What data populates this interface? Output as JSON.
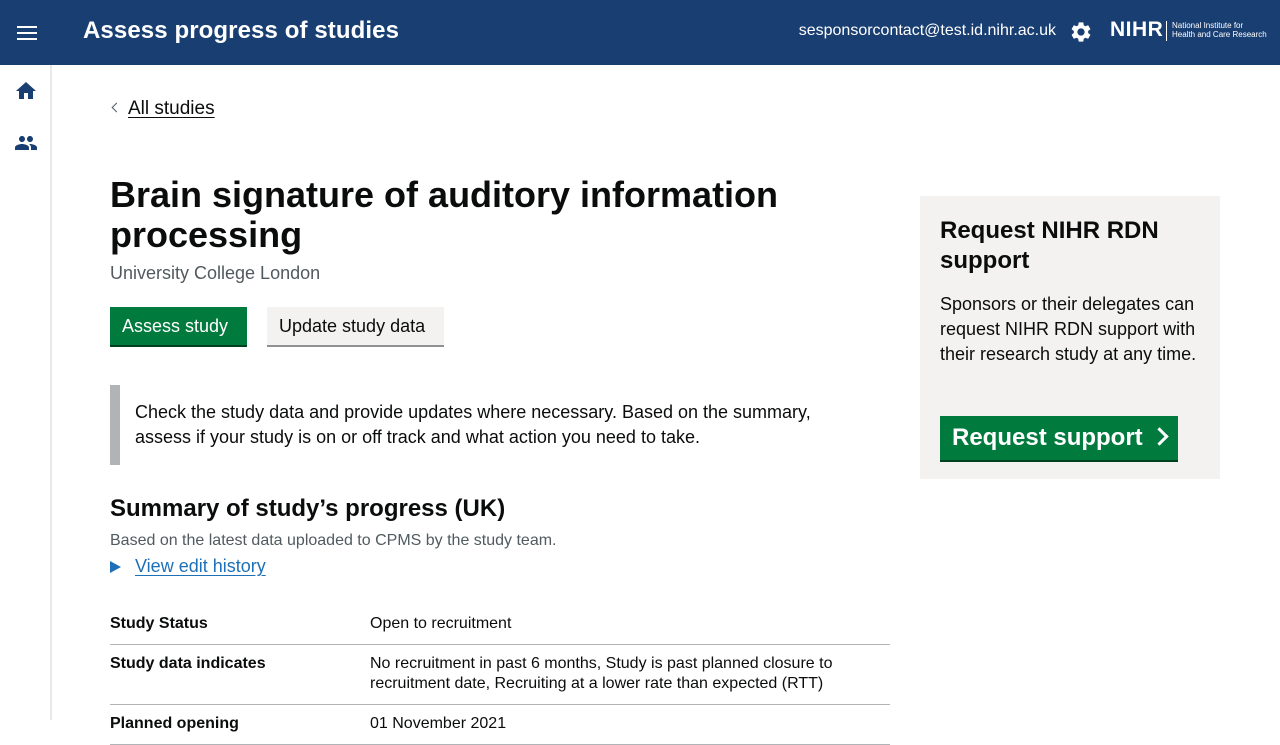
{
  "header": {
    "app_title": "Assess progress of studies",
    "user_email": "sesponsorcontact@test.id.nihr.ac.uk",
    "logo_text": "NIHR",
    "logo_subtitle_line1": "National Institute for",
    "logo_subtitle_line2": "Health and Care Research"
  },
  "back_link": "All studies",
  "study": {
    "title": "Brain signature of auditory information processing",
    "organisation": "University College London"
  },
  "actions": {
    "assess": "Assess study",
    "update": "Update study data"
  },
  "inset_text": "Check the study data and provide updates where necessary. Based on the summary, assess if your study is on or off track and what action you need to take.",
  "summary": {
    "title": "Summary of study’s progress (UK)",
    "subtitle": "Based on the latest data uploaded to CPMS by the study team.",
    "details_link": "View edit history",
    "rows": [
      {
        "key": "Study Status",
        "value": "Open to recruitment"
      },
      {
        "key": "Study data indicates",
        "value": "No recruitment in past 6 months, Study is past planned closure to recruitment date, Recruiting at a lower rate than expected (RTT)"
      },
      {
        "key": "Planned opening",
        "value": "01 November 2021"
      }
    ]
  },
  "aside": {
    "title": "Request NIHR RDN support",
    "body": "Sponsors or their delegates can request NIHR RDN support with their research study at any time.",
    "button": "Request support"
  },
  "colors": {
    "header_bg": "#193e72",
    "primary_button": "#007a3d",
    "link": "#1d70b8"
  }
}
